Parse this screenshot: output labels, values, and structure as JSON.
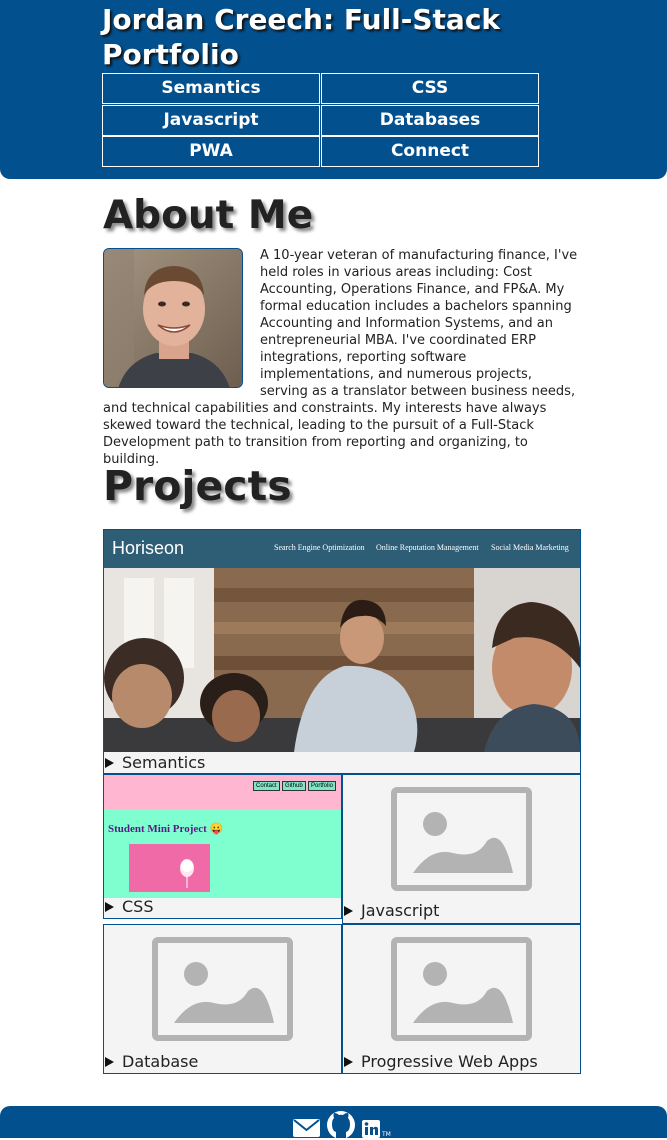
{
  "header": {
    "title": "Jordan Creech: Full-Stack Portfolio",
    "nav": [
      "Semantics",
      "CSS",
      "Javascript",
      "Databases",
      "PWA",
      "Connect"
    ]
  },
  "about": {
    "heading": "About Me",
    "paragraph": "A 10-year veteran of manufacturing finance, I've held roles in various areas including: Cost Accounting, Operations Finance, and FP&A. My formal education includes a bachelors spanning Accounting and Information Systems, and an entrepreneurial MBA. I've coordinated ERP integrations, reporting software implementations, and numerous projects, serving as a translator between business needs, and technical capabilities and constraints. My interests have always skewed toward the technical, leading to the pursuit of a Full-Stack Development path to transition from reporting and organizing, to building."
  },
  "projects": {
    "heading": "Projects",
    "featured": {
      "label": "Semantics",
      "preview": {
        "brand": "Horiseon",
        "links": [
          "Search Engine Optimization",
          "Online Reputation Management",
          "Social Media Marketing"
        ]
      }
    },
    "items": [
      {
        "label": "CSS",
        "preview": {
          "buttons": [
            "Contact",
            "Github",
            "Portfolio"
          ],
          "title": "Student Mini Project 😛"
        }
      },
      {
        "label": "Javascript"
      },
      {
        "label": "Database"
      },
      {
        "label": "Progressive Web Apps"
      }
    ]
  },
  "footer": {
    "icons": [
      "mail-icon",
      "github-icon",
      "linkedin-icon"
    ]
  }
}
